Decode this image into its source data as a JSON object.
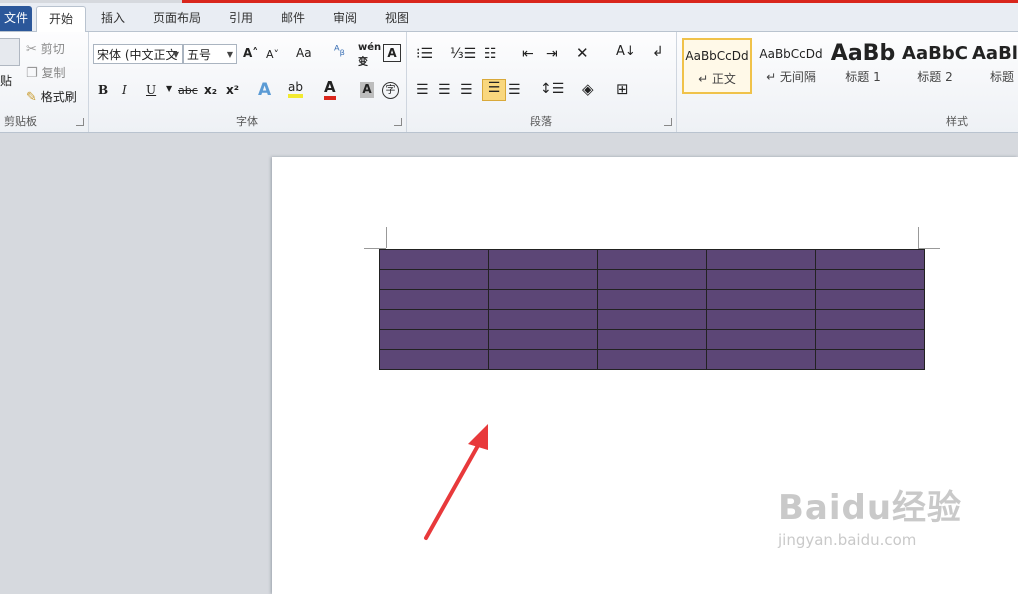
{
  "colors": {
    "accent_red": "#d9261c",
    "table_fill": "#5c4676",
    "file_tab": "#2b579a",
    "arrow": "#e8393b"
  },
  "tabs": [
    {
      "label": "文件"
    },
    {
      "label": "开始"
    },
    {
      "label": "插入"
    },
    {
      "label": "页面布局"
    },
    {
      "label": "引用"
    },
    {
      "label": "邮件"
    },
    {
      "label": "审阅"
    },
    {
      "label": "视图"
    }
  ],
  "clipboard": {
    "paste": "贴",
    "cut": "剪切",
    "copy": "复制",
    "format_painter": "格式刷",
    "group_label": "剪贴板"
  },
  "font": {
    "font_name": "宋体 (中文正文",
    "font_size": "五号",
    "group_label": "字体",
    "bold": "B",
    "italic": "I",
    "underline": "U",
    "strike": "abc",
    "subscript": "x₂",
    "superscript": "x²",
    "grow": "A˄",
    "shrink": "A˅",
    "case": "Aa"
  },
  "paragraph": {
    "group_label": "段落"
  },
  "styles": {
    "group_label": "样式",
    "items": [
      {
        "sample": "AaBbCcDd",
        "name": "↵ 正文"
      },
      {
        "sample": "AaBbCcDd",
        "name": "↵ 无间隔"
      },
      {
        "sample": "AaBb",
        "name": "标题 1"
      },
      {
        "sample": "AaBbC",
        "name": "标题 2"
      },
      {
        "sample": "AaBl",
        "name": "标题"
      }
    ]
  },
  "table": {
    "rows": 6,
    "cols": 5
  },
  "watermark": {
    "logo": "Baidu经验",
    "url": "jingyan.baidu.com"
  }
}
